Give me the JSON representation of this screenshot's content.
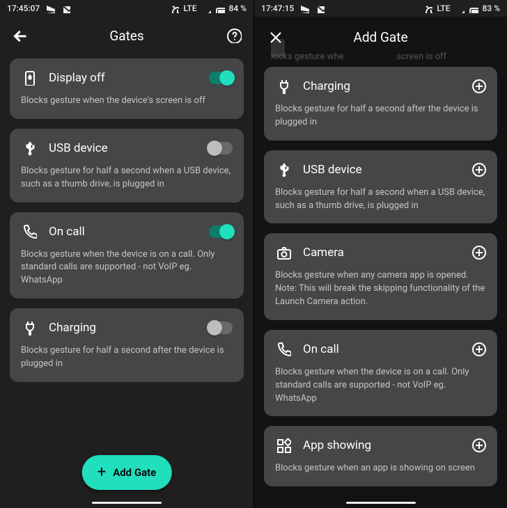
{
  "left": {
    "status": {
      "time": "17:45:07",
      "network": "LTE",
      "battery": "84 %"
    },
    "title": "Gates",
    "items": [
      {
        "key": "display-off",
        "title": "Display off",
        "desc": "Blocks gesture when the device's screen is off",
        "toggle": true
      },
      {
        "key": "usb-device",
        "title": "USB device",
        "desc": "Blocks gesture for half a second when a USB device, such as a thumb drive, is plugged in",
        "toggle": false
      },
      {
        "key": "on-call",
        "title": "On call",
        "desc": "Blocks gesture when the device is on a call. Only standard calls are supported - not VoIP eg. WhatsApp",
        "toggle": true
      },
      {
        "key": "charging",
        "title": "Charging",
        "desc": "Blocks gesture for half a second after the device is plugged in",
        "toggle": false
      }
    ],
    "fab_label": "Add Gate"
  },
  "right": {
    "status": {
      "time": "17:47:15",
      "network": "LTE",
      "battery": "83 %"
    },
    "scrim_text_a": "locks gesture whe",
    "scrim_text_b": "screen is off",
    "title": "Add Gate",
    "items": [
      {
        "key": "charging",
        "title": "Charging",
        "desc": "Blocks gesture for half a second after the device is plugged in"
      },
      {
        "key": "usb-device",
        "title": "USB device",
        "desc": "Blocks gesture for half a second when a USB device, such as a thumb drive, is plugged in"
      },
      {
        "key": "camera",
        "title": "Camera",
        "desc": "Blocks gesture when any camera app is opened. Note: This will break the skipping functionality of the Launch Camera action."
      },
      {
        "key": "on-call",
        "title": "On call",
        "desc": "Blocks gesture when the device is on a call. Only standard calls are supported - not VoIP eg. WhatsApp"
      },
      {
        "key": "app-showing",
        "title": "App showing",
        "desc": "Blocks gesture when an app is showing on screen"
      }
    ]
  }
}
